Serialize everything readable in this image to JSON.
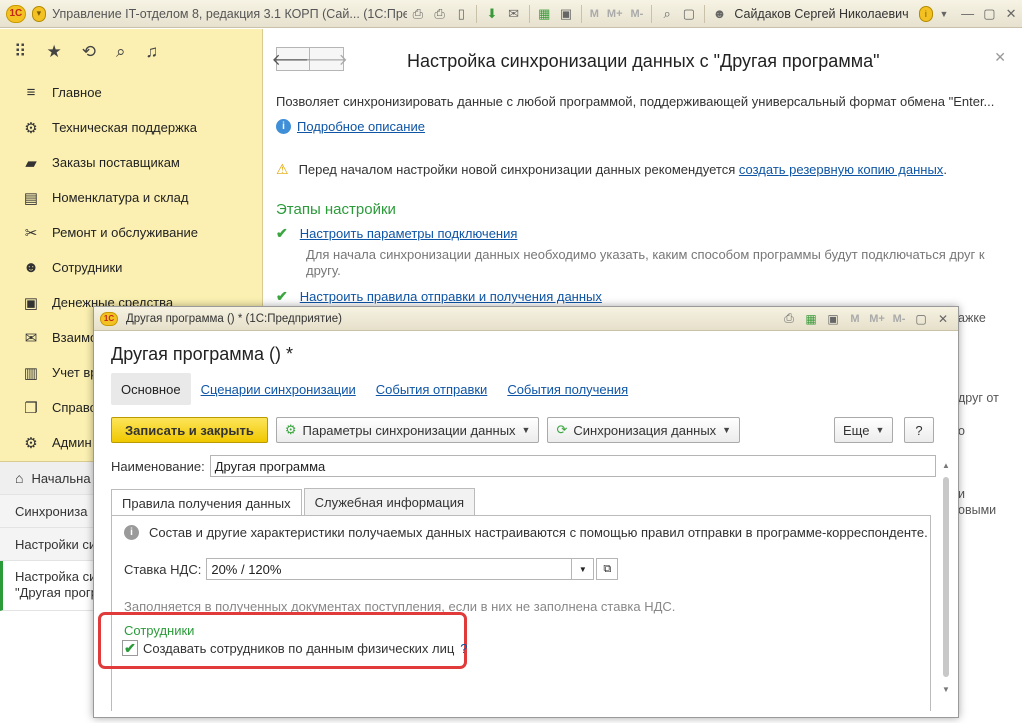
{
  "app": {
    "title": "Управление IT-отделом 8, редакция 3.1 КОРП (Сай... (1С:Предприятие)",
    "user": "Сайдаков Сергей Николаевич",
    "logo_text": "1С"
  },
  "sidebar": {
    "items": [
      {
        "label": "Главное",
        "icon": "menu-icon",
        "glyph": "≡"
      },
      {
        "label": "Техническая поддержка",
        "icon": "support-icon",
        "glyph": "⚙"
      },
      {
        "label": "Заказы поставщикам",
        "icon": "truck-icon",
        "glyph": "▰"
      },
      {
        "label": "Номенклатура и склад",
        "icon": "printer-icon",
        "glyph": "▤"
      },
      {
        "label": "Ремонт и обслуживание",
        "icon": "tools-icon",
        "glyph": "✂"
      },
      {
        "label": "Сотрудники",
        "icon": "people-icon",
        "glyph": "☻"
      },
      {
        "label": "Денежные средства",
        "icon": "money-icon",
        "glyph": "▣"
      },
      {
        "label": "Взаимо",
        "icon": "mail-icon",
        "glyph": "✉"
      },
      {
        "label": "Учет вр",
        "icon": "clipboard-icon",
        "glyph": "▥"
      },
      {
        "label": "Справо",
        "icon": "book-icon",
        "glyph": "❐"
      },
      {
        "label": "Админ",
        "icon": "gear-icon",
        "glyph": "⚙"
      }
    ],
    "lower": {
      "home": "Начальна",
      "sync": "Синхрониза",
      "settings": "Настройки си",
      "active_line1": "Настройка си",
      "active_line2": "\"Другая прогр"
    }
  },
  "main": {
    "title": "Настройка синхронизации данных с \"Другая программа\"",
    "description": "Позволяет синхронизировать данные с любой программой, поддерживающей универсальный формат обмена \"Enter...",
    "info_link": "Подробное описание",
    "warning_text": "Перед началом настройки новой синхронизации данных рекомендуется",
    "warning_link": "создать резервную копию данных",
    "warning_end": ".",
    "stages_title": "Этапы настройки",
    "stage1_link": "Настроить параметры подключения",
    "stage1_note": "Для начала синхронизации данных необходимо указать, каким способом программы будут подключаться друг к другу.",
    "stage2_link": "Настроить правила отправки и получения данных",
    "clip_a": "ажке",
    "clip_b": "друг от",
    "clip_c": "о",
    "clip_d": "и",
    "clip_e": "овыми"
  },
  "modal": {
    "window_title": "Другая программа () * (1С:Предприятие)",
    "heading": "Другая программа () *",
    "tabs": [
      "Основное",
      "Сценарии синхронизации",
      "События отправки",
      "События получения"
    ],
    "btn_save": "Записать и закрыть",
    "btn_params": "Параметры синхронизации данных",
    "btn_sync": "Синхронизация данных",
    "btn_more": "Еще",
    "btn_help": "?",
    "name_label": "Наименование:",
    "name_value": "Другая программа",
    "inner_tabs": [
      "Правила получения данных",
      "Служебная информация"
    ],
    "info_text": "Состав и другие характеристики получаемых данных настраиваются с помощью правил отправки в программе-корреспонденте.",
    "vat_label": "Ставка НДС:",
    "vat_value": "20% / 120%",
    "vat_hint": "Заполняется в полученных документах поступления, если в них не заполнена ставка НДС.",
    "employees_group": "Сотрудники",
    "employees_checkbox": "Создавать сотрудников по данным физических лиц",
    "employees_checked": true,
    "employees_help": "?"
  },
  "colors": {
    "accent_green": "#2b9b3a",
    "link": "#0e55a6",
    "highlight": "#e03a3a",
    "sidebar": "#fbf0b1"
  }
}
